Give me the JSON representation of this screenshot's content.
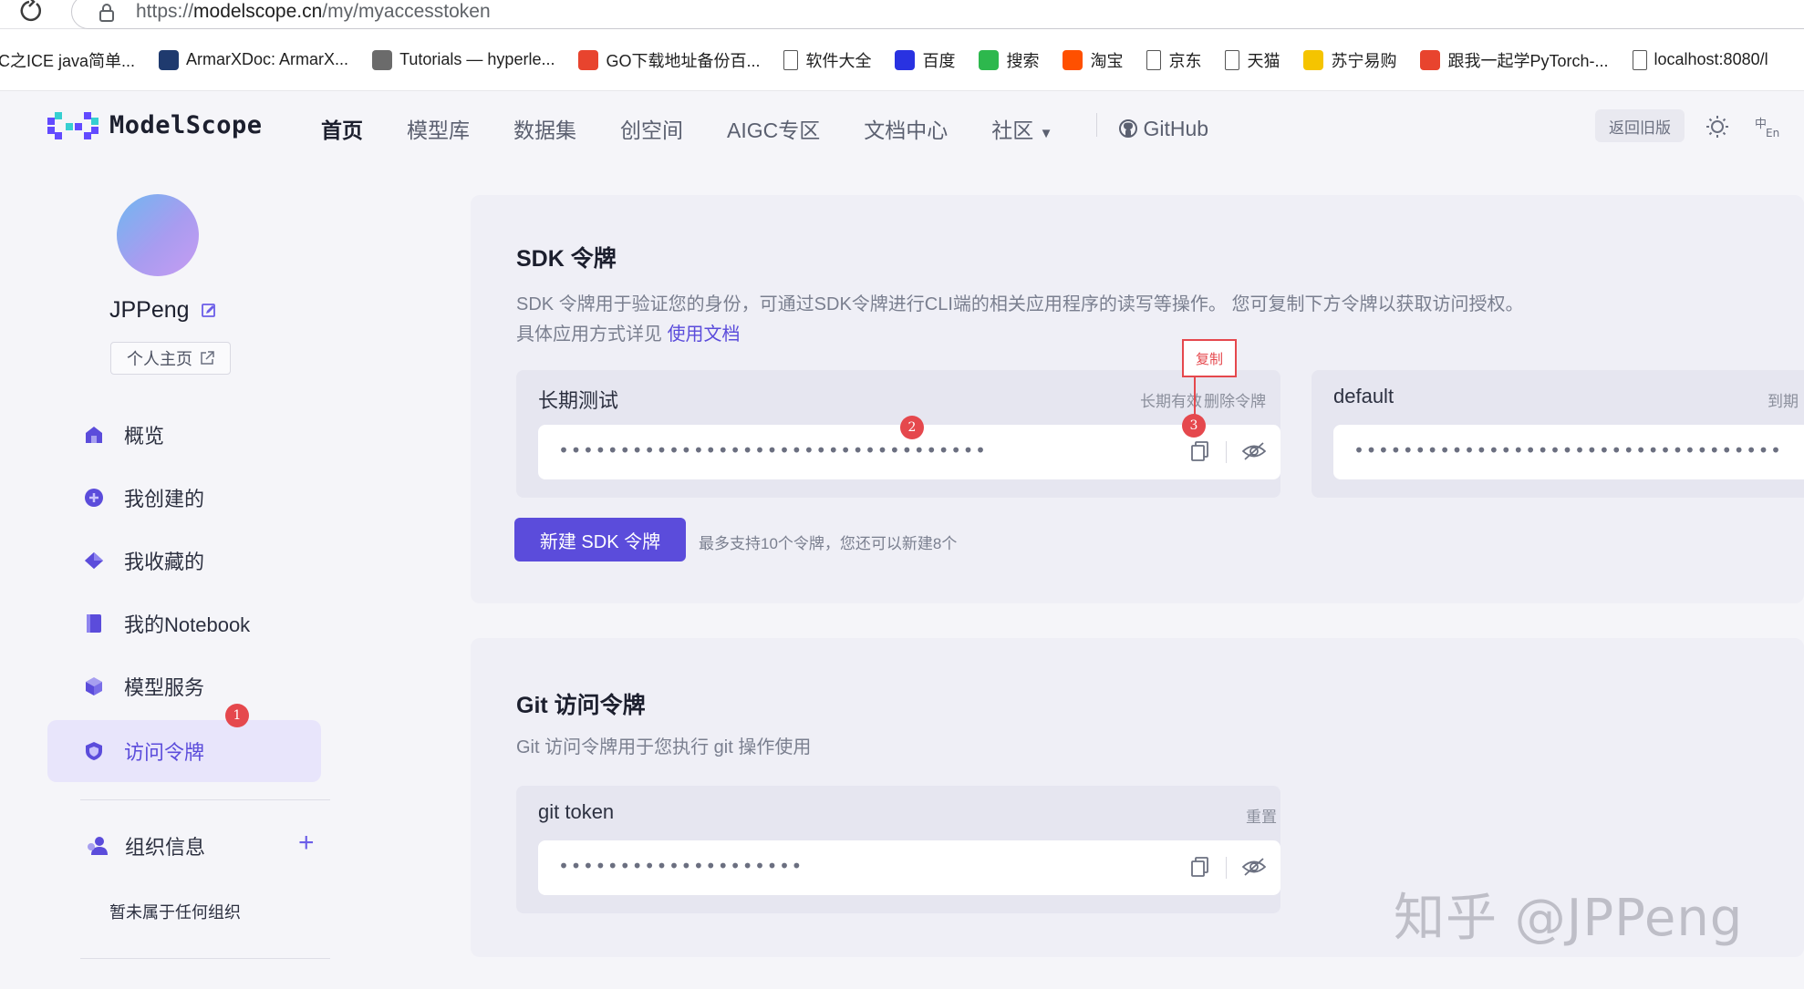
{
  "browser": {
    "url_prefix": "https://",
    "url_host": "modelscope.cn",
    "url_path": "/my/myaccesstoken",
    "bookmarks": [
      {
        "label": "C之ICE java简单...",
        "icon": "c-icon",
        "color": "#ffffff"
      },
      {
        "label": "ArmarXDoc: ArmarX...",
        "icon": "armarx-icon",
        "color": "#1f3a6e"
      },
      {
        "label": "Tutorials — hyperle...",
        "icon": "book-icon",
        "color": "#6b6b6b"
      },
      {
        "label": "GO下载地址备份百...",
        "icon": "csdn-icon",
        "color": "#e8442e"
      },
      {
        "label": "软件大全",
        "icon": "page-icon",
        "color": "#ffffff"
      },
      {
        "label": "百度",
        "icon": "baidu-icon",
        "color": "#2932e1"
      },
      {
        "label": "搜索",
        "icon": "search-engine-icon",
        "color": "#2db84d"
      },
      {
        "label": "淘宝",
        "icon": "taobao-icon",
        "color": "#ff5000"
      },
      {
        "label": "京东",
        "icon": "page-icon",
        "color": "#ffffff"
      },
      {
        "label": "天猫",
        "icon": "page-icon",
        "color": "#ffffff"
      },
      {
        "label": "苏宁易购",
        "icon": "suning-icon",
        "color": "#f5c400"
      },
      {
        "label": "跟我一起学PyTorch-...",
        "icon": "csdn-icon",
        "color": "#e8442e"
      },
      {
        "label": "localhost:8080/l",
        "icon": "page-icon",
        "color": "#ffffff"
      }
    ]
  },
  "header": {
    "logo_text": "ModelScope",
    "nav": [
      "首页",
      "模型库",
      "数据集",
      "创空间",
      "AIGC专区",
      "文档中心",
      "社区"
    ],
    "github": "GitHub",
    "legacy_button": "返回旧版",
    "accent": "#5b4cdb"
  },
  "sidebar": {
    "username": "JPPeng",
    "home_button": "个人主页",
    "items": [
      {
        "label": "概览",
        "icon": "home-icon"
      },
      {
        "label": "我创建的",
        "icon": "plus-circle-icon"
      },
      {
        "label": "我收藏的",
        "icon": "diamond-icon"
      },
      {
        "label": "我的Notebook",
        "icon": "notebook-icon"
      },
      {
        "label": "模型服务",
        "icon": "cube-icon"
      },
      {
        "label": "访问令牌",
        "icon": "shield-icon"
      }
    ],
    "org_title": "组织信息",
    "org_empty": "暂未属于任何组织"
  },
  "annotations": {
    "badge1": "1",
    "badge2": "2",
    "badge3": "3",
    "copy_tip": "复制"
  },
  "sdk": {
    "title": "SDK 令牌",
    "desc_line1": "SDK 令牌用于验证您的身份，可通过SDK令牌进行CLI端的相关应用程序的读写等操作。 您可复制下方令牌以获取访问授权。",
    "desc_line2": "具体应用方式详见",
    "desc_link": "使用文档",
    "tokens": [
      {
        "name": "长期测试",
        "validity": "长期有效",
        "delete": "删除令牌",
        "masked": "•••••••••••••••••••••••••••••••••••"
      },
      {
        "name": "default",
        "validity": "到期",
        "masked": "•••••••••••••••••••••••••••••••••••"
      }
    ],
    "new_button": "新建 SDK 令牌",
    "limit_text": "最多支持10个令牌，您还可以新建8个"
  },
  "git": {
    "title": "Git 访问令牌",
    "desc": "Git 访问令牌用于您执行 git 操作使用",
    "token_name": "git token",
    "reset": "重置",
    "masked": "••••••••••••••••••••"
  },
  "watermark": "知乎 @JPPeng"
}
